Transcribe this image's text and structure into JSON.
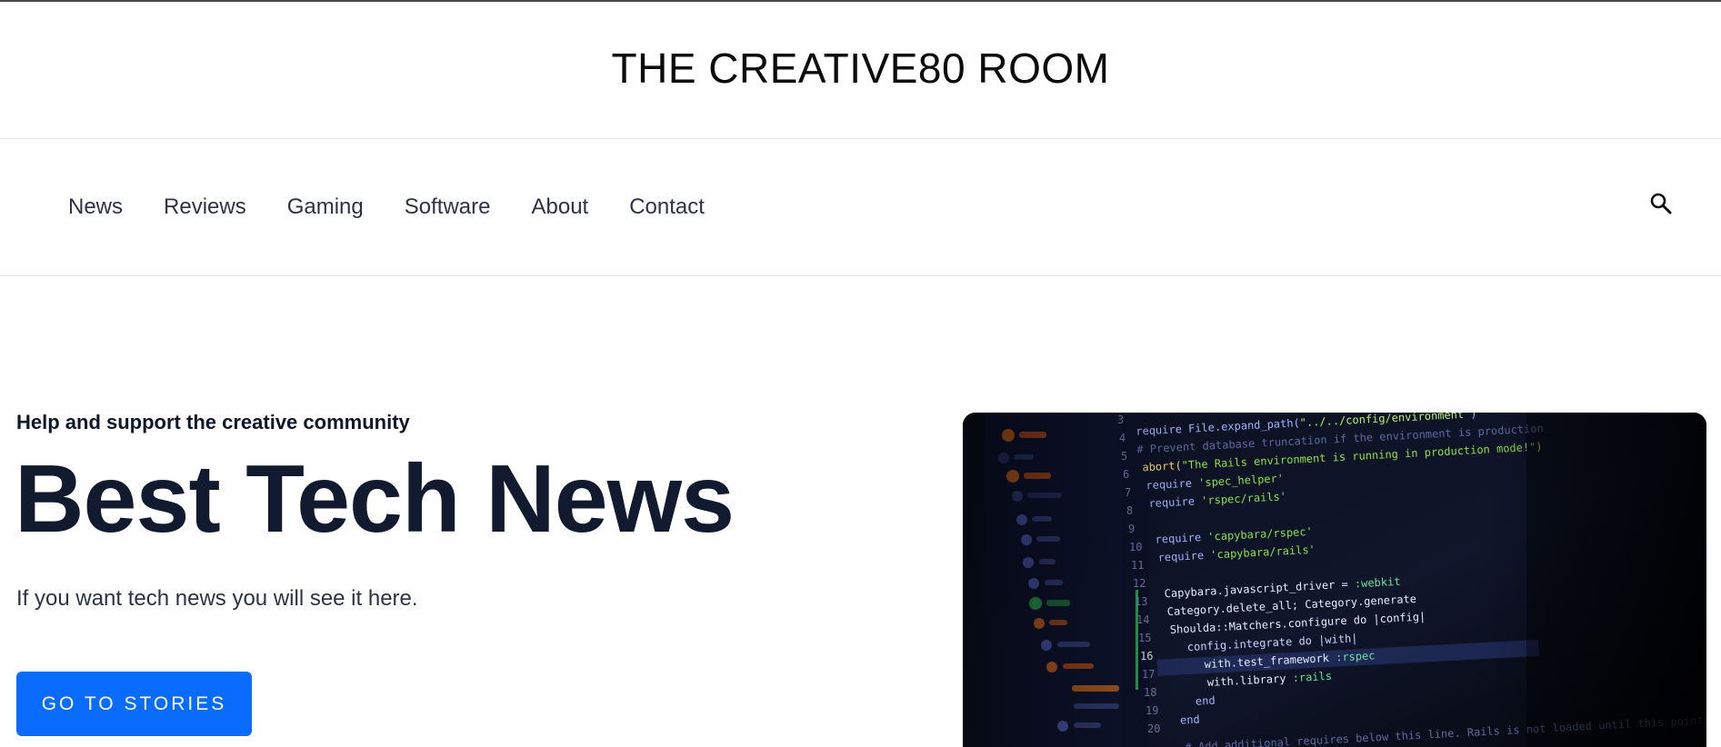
{
  "header": {
    "site_title": "THE CREATIVE80 ROOM"
  },
  "nav": {
    "items": [
      "News",
      "Reviews",
      "Gaming",
      "Software",
      "About",
      "Contact"
    ],
    "search_icon": "search-icon"
  },
  "hero": {
    "tagline": "Help and support the creative community",
    "headline": "Best Tech News",
    "subtext": "If you want tech news you will see it here.",
    "cta_label": "GO TO STORIES",
    "image_icon": "code-editor-image"
  },
  "colors": {
    "accent": "#0a6cff",
    "text_dark": "#111a2e",
    "nav_text": "#2b3445"
  }
}
